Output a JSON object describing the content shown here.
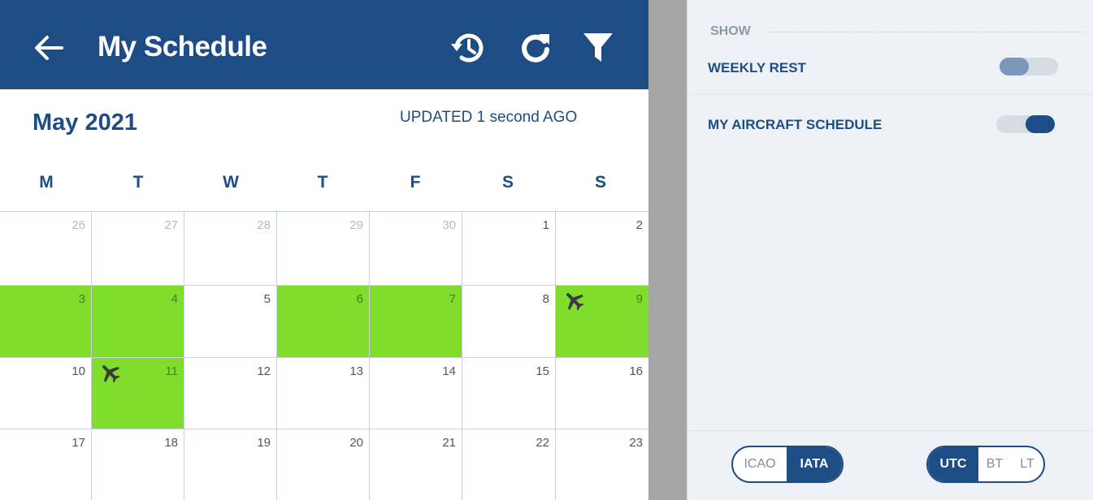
{
  "header": {
    "title": "My Schedule",
    "icons": [
      "back-arrow-icon",
      "history-icon",
      "refresh-icon",
      "filter-icon"
    ],
    "color": "#1e4d85"
  },
  "calendar": {
    "month": "May 2021",
    "updated": "UPDATED 1 second AGO",
    "weekdays": [
      "M",
      "T",
      "W",
      "T",
      "F",
      "S",
      "S"
    ],
    "duty_color": "#80dd2c",
    "weeks": [
      [
        {
          "day": "26",
          "muted": true,
          "duty": false,
          "flight": false
        },
        {
          "day": "27",
          "muted": true,
          "duty": false,
          "flight": false
        },
        {
          "day": "28",
          "muted": true,
          "duty": false,
          "flight": false
        },
        {
          "day": "29",
          "muted": true,
          "duty": false,
          "flight": false
        },
        {
          "day": "30",
          "muted": true,
          "duty": false,
          "flight": false
        },
        {
          "day": "1",
          "muted": false,
          "duty": false,
          "flight": false
        },
        {
          "day": "2",
          "muted": false,
          "duty": false,
          "flight": false
        }
      ],
      [
        {
          "day": "3",
          "muted": false,
          "duty": true,
          "flight": false
        },
        {
          "day": "4",
          "muted": false,
          "duty": true,
          "flight": false
        },
        {
          "day": "5",
          "muted": false,
          "duty": false,
          "flight": false
        },
        {
          "day": "6",
          "muted": false,
          "duty": true,
          "flight": false
        },
        {
          "day": "7",
          "muted": false,
          "duty": true,
          "flight": false
        },
        {
          "day": "8",
          "muted": false,
          "duty": false,
          "flight": false
        },
        {
          "day": "9",
          "muted": false,
          "duty": true,
          "flight": true
        }
      ],
      [
        {
          "day": "10",
          "muted": false,
          "duty": false,
          "flight": false
        },
        {
          "day": "11",
          "muted": false,
          "duty": true,
          "flight": true
        },
        {
          "day": "12",
          "muted": false,
          "duty": false,
          "flight": false
        },
        {
          "day": "13",
          "muted": false,
          "duty": false,
          "flight": false
        },
        {
          "day": "14",
          "muted": false,
          "duty": false,
          "flight": false
        },
        {
          "day": "15",
          "muted": false,
          "duty": false,
          "flight": false
        },
        {
          "day": "16",
          "muted": false,
          "duty": false,
          "flight": false
        }
      ],
      [
        {
          "day": "17",
          "muted": false,
          "duty": false,
          "flight": false
        },
        {
          "day": "18",
          "muted": false,
          "duty": false,
          "flight": false
        },
        {
          "day": "19",
          "muted": false,
          "duty": false,
          "flight": false
        },
        {
          "day": "20",
          "muted": false,
          "duty": false,
          "flight": false
        },
        {
          "day": "21",
          "muted": false,
          "duty": false,
          "flight": false
        },
        {
          "day": "22",
          "muted": false,
          "duty": false,
          "flight": false
        },
        {
          "day": "23",
          "muted": false,
          "duty": false,
          "flight": false
        }
      ]
    ]
  },
  "filters": {
    "section_label": "SHOW",
    "options": [
      {
        "label": "WEEKLY REST",
        "on": false
      },
      {
        "label": "MY AIRCRAFT SCHEDULE",
        "on": true
      }
    ],
    "code_format": {
      "options": [
        "ICAO",
        "IATA"
      ],
      "selected": "IATA"
    },
    "time_format": {
      "options": [
        "UTC",
        "BT",
        "LT"
      ],
      "selected": "UTC"
    }
  }
}
